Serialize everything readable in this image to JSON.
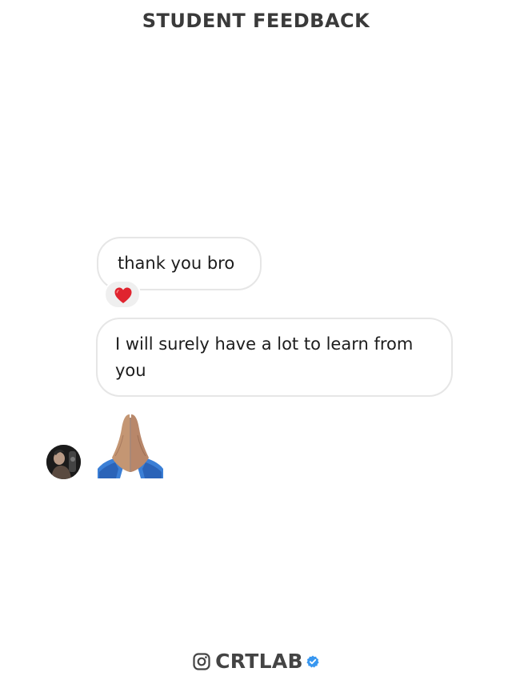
{
  "header": {
    "title": "STUDENT FEEDBACK"
  },
  "messages": [
    {
      "text": "thank you bro",
      "reaction": "heart-emoji"
    },
    {
      "text": "I will surely have a lot to learn from you"
    },
    {
      "emoji": "folded-hands-emoji"
    }
  ],
  "footer": {
    "brand": "CRTLAB",
    "platform_icon": "instagram-icon",
    "badge_icon": "verified-badge-icon"
  },
  "colors": {
    "title": "#3a3a3a",
    "bubble_border": "#e6e6e6",
    "heart": "#e0242f",
    "verified": "#3897f0",
    "brand": "#444444"
  }
}
